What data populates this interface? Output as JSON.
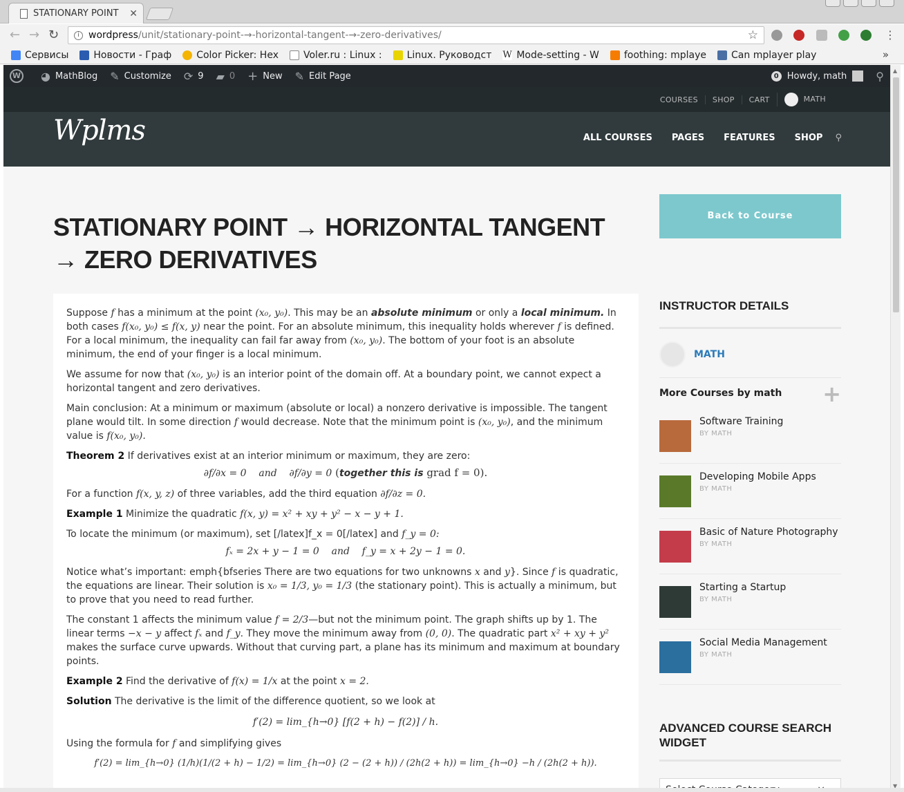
{
  "browser": {
    "tab_title": "STATIONARY POINT",
    "url_host": "wordpress",
    "url_path": "/unit/stationary-point-→-horizontal-tangent-→-zero-derivatives/",
    "bookmarks": [
      {
        "label": "Сервисы",
        "color": "#4285f4"
      },
      {
        "label": "Новости - Граф",
        "color": "#2a5db0"
      },
      {
        "label": "Color Picker: Hex",
        "color": "#f4b400"
      },
      {
        "label": "Voler.ru : Linux :",
        "color": "#999999"
      },
      {
        "label": "Linux. Руководст",
        "color": "#e8d400"
      },
      {
        "label": "Mode-setting - W",
        "color": "#ffffff"
      },
      {
        "label": "foothing: mplaye",
        "color": "#f57c00"
      },
      {
        "label": "Can mplayer play",
        "color": "#4a6fa5"
      }
    ],
    "more": "»"
  },
  "adminbar": {
    "site": "MathBlog",
    "customize": "Customize",
    "updates": "9",
    "comments": "0",
    "new": "New",
    "edit": "Edit Page",
    "notif_count": "0",
    "howdy": "Howdy, math"
  },
  "topnav": {
    "courses": "COURSES",
    "shop": "SHOP",
    "cart": "CART",
    "user": "MATH"
  },
  "header": {
    "logo": "Wplms",
    "nav": [
      "ALL COURSES",
      "PAGES",
      "FEATURES",
      "SHOP"
    ]
  },
  "page": {
    "title": "STATIONARY POINT → HORIZONTAL TANGENT → ZERO DERIVATIVES"
  },
  "article": {
    "p1a": "Suppose ",
    "p1b": " has a minimum at the point ",
    "p1c": ". This may be an ",
    "p1d": "absolute minimum",
    "p1e": " or only a ",
    "p1f": "local minimum.",
    "p1g": " In both cases ",
    "p1h": " near the point. For an absolute minimum, this inequality holds wherever ",
    "p1i": " is defined. For a local minimum, the inequality can fail far away from ",
    "p1j": ". The bottom of your foot is an absolute minimum, the end of your finger is a local minimum.",
    "p2a": "We assume for now that ",
    "p2b": " is an interior point of the domain off. At a boundary point, we cannot expect a horizontal tangent and zero derivatives.",
    "p3a": "Main conclusion: At a minimum or maximum (absolute or local) a nonzero derivative is impossible. The tangent plane would tilt. In some direction ",
    "p3b": " would decrease. Note that the minimum point is ",
    "p3c": ", and the minimum value is ",
    "theorem_label": "Theorem 2",
    "theorem_text": " If derivatives exist at an interior minimum or maximum, they are zero:",
    "eq1": "∂f/∂x = 0    and    ∂f/∂y = 0",
    "eq1_note": "together this is",
    "eq1_tail": "grad f = 0).",
    "p4a": "For a function ",
    "p4b": " of three variables, add the third equation ",
    "ex1_label": "Example 1",
    "ex1_text": " Minimize the quadratic ",
    "ex1_math": "f(x, y) = x² + xy + y² − x − y + 1.",
    "p5a": "To locate the minimum (or maximum), set [/latex]f_x = 0[/latex] and ",
    "eq2": "fₓ = 2x + y − 1 = 0    and    f_y = x + 2y − 1 = 0.",
    "p6a": "Notice what’s important: emph{bfseries There are two equations for two unknowns ",
    "p6b": " and ",
    "p6c": "}. Since ",
    "p6d": " is quadratic, the equations are linear. Their solution is ",
    "p6e": " (the stationary point). This is actually a minimum, but to prove that you need to read further.",
    "p7a": "The constant 1 affects the minimum value ",
    "p7b": "—but not the minimum point. The graph shifts up by 1. The linear terms ",
    "p7c": " affect ",
    "p7d": " and ",
    "p7e": ". They move the minimum away from ",
    "p7f": ". The quadratic part ",
    "p7g": " makes the surface curve upwards. Without that curving part, a plane has its minimum and maximum at boundary points.",
    "ex2_label": "Example 2",
    "ex2_text": " Find the derivative of ",
    "ex2_mid": " at the point ",
    "sol_label": "Solution",
    "sol_text": " The derivative is the limit of the difference quotient, so we look at",
    "eq3": "f′(2) = lim_{h→0} [f(2 + h) − f(2)] / h.",
    "p8a": "Using the formula for ",
    "p8b": " and simplifying gives",
    "eq4": "f′(2) = lim_{h→0} (1/h)(1/(2 + h) − 1/2) = lim_{h→0} (2 − (2 + h)) / (2h(2 + h)) = lim_{h→0} −h / (2h(2 + h))."
  },
  "math": {
    "f": "f",
    "x0y0": "(x₀, y₀)",
    "ineq": "f(x₀, y₀) ≤ f(x, y)",
    "fx0y0": "f(x₀, y₀).",
    "fxyz": "f(x, y, z)",
    "dfdz": "∂f/∂z = 0.",
    "fy0": "f_y = 0:",
    "x": "x",
    "y": "y",
    "sol": "x₀ = 1/3, y₀ = 1/3",
    "fmin": "f = 2/3",
    "lin": "−x − y",
    "fx": "fₓ",
    "fy": "f_y",
    "origin": "(0, 0)",
    "quad": "x² + xy + y²",
    "f1x": "f(x) = 1/x",
    "x2": "x = 2."
  },
  "sidebar": {
    "back": "Back to Course",
    "instructor_title": "INSTRUCTOR DETAILS",
    "instructor_name": "MATH",
    "more_courses": "More Courses by math",
    "courses": [
      {
        "title": "Software Training",
        "by": "BY MATH",
        "color": "#b86a3c"
      },
      {
        "title": "Developing Mobile Apps",
        "by": "BY MATH",
        "color": "#5a7a2a"
      },
      {
        "title": "Basic of Nature Photography",
        "by": "BY MATH",
        "color": "#c43c4a"
      },
      {
        "title": "Starting a Startup",
        "by": "BY MATH",
        "color": "#2e3a36"
      },
      {
        "title": "Social Media Management",
        "by": "BY MATH",
        "color": "#2a6f9e"
      }
    ],
    "search_title": "ADVANCED COURSE SEARCH WIDGET",
    "select_placeholder": "Select Course Category",
    "clear": "×"
  }
}
